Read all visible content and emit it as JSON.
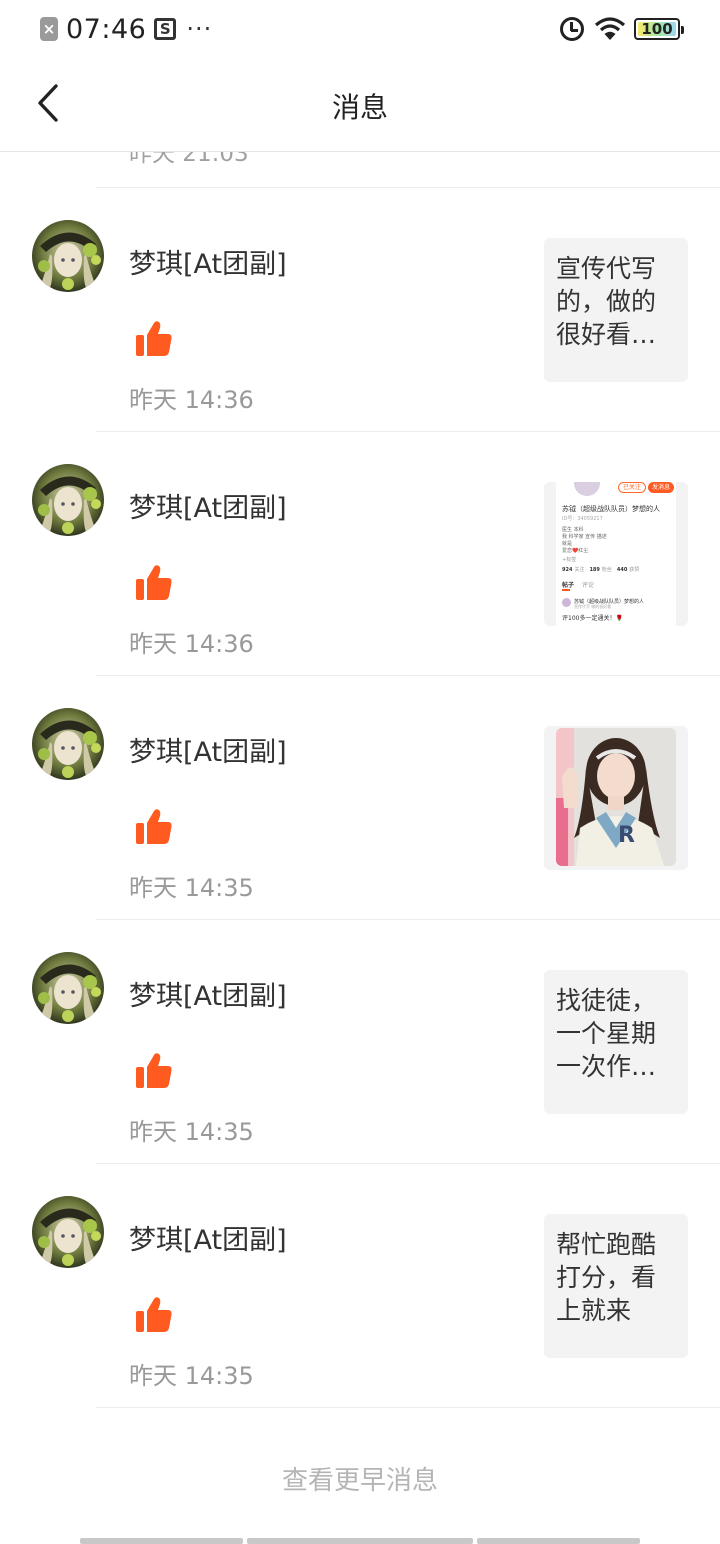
{
  "status_bar": {
    "time": "07:46",
    "dots": "···",
    "battery": "100"
  },
  "nav": {
    "title": "消息"
  },
  "cut_row": {
    "time": "昨天 21:03"
  },
  "messages": [
    {
      "user": "梦琪[At团副]",
      "time": "昨天 14:36",
      "preview_type": "text",
      "preview_text": "宣传代写的，做的很好看…"
    },
    {
      "user": "梦琪[At团副]",
      "time": "昨天 14:36",
      "preview_type": "screenshot",
      "shot": {
        "follow_label": "已关注",
        "chat_label": "发消息",
        "name": "苏钺（超级战队队员）梦想的人",
        "id_line": "ID号：34059217",
        "bio1": "医生 本科",
        "bio2": "我 科学家 宣传 描述",
        "bio3": "就是",
        "bio4": "爱恋❤️红尘",
        "tag": "+标签",
        "stat1": "924",
        "stat1_label": "关注",
        "stat2": "189",
        "stat2_label": "粉丝",
        "stat3": "440",
        "stat3_label": "获赞",
        "tab1": "帖子",
        "tab2": "评论",
        "post_title": "苏钺（超级战队队员）梦想的人",
        "post_line": "宣传代写 做的很好看",
        "post_body": "评100多一定通关！🌹"
      }
    },
    {
      "user": "梦琪[At团副]",
      "time": "昨天 14:35",
      "preview_type": "photo",
      "photo_letter": "R"
    },
    {
      "user": "梦琪[At团副]",
      "time": "昨天 14:35",
      "preview_type": "text",
      "preview_text": "找徒徒，一个星期一次作…"
    },
    {
      "user": "梦琪[At团副]",
      "time": "昨天 14:35",
      "preview_type": "text",
      "preview_text": "帮忙跑酷打分，看上就来"
    }
  ],
  "footer": {
    "more": "查看更早消息"
  },
  "colors": {
    "accent": "#ff5a1f",
    "divider": "#ececec",
    "muted": "#999999"
  }
}
